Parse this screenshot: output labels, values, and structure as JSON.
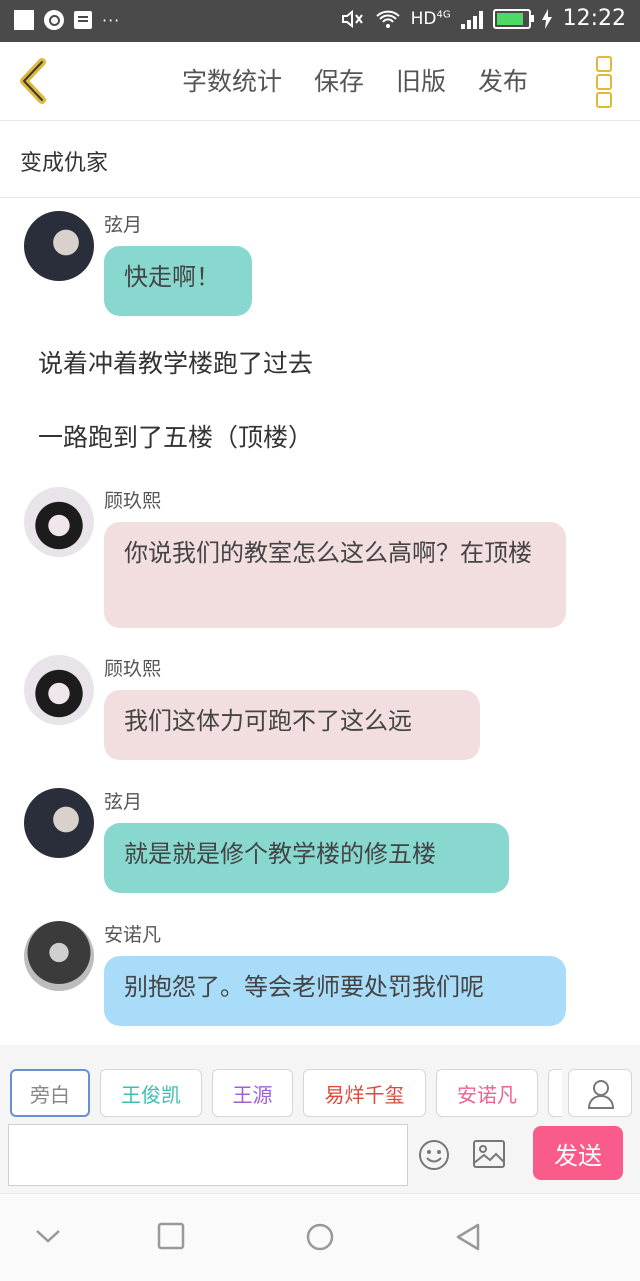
{
  "status_bar": {
    "network": "HD",
    "network_type": "4G",
    "time": "12:22"
  },
  "toolbar": {
    "actions": [
      "字数统计",
      "保存",
      "旧版",
      "发布"
    ]
  },
  "chapter": {
    "title": "变成仇家"
  },
  "messages": [
    {
      "type": "chat",
      "name": "弦月",
      "text": "快走啊！",
      "color": "teal"
    },
    {
      "type": "narration",
      "text": "说着冲着教学楼跑了过去"
    },
    {
      "type": "narration",
      "text": "一路跑到了五楼（顶楼）"
    },
    {
      "type": "chat",
      "name": "顾玖熙",
      "text": "你说我们的教室怎么这么高啊？在顶楼",
      "color": "pink"
    },
    {
      "type": "chat",
      "name": "顾玖熙",
      "text": "我们这体力可跑不了这么远",
      "color": "pink"
    },
    {
      "type": "chat",
      "name": "弦月",
      "text": "就是就是修个教学楼的修五楼",
      "color": "teal"
    },
    {
      "type": "chat",
      "name": "安诺凡",
      "text": "别抱怨了。等会老师要处罚我们呢",
      "color": "blue"
    }
  ],
  "characters": [
    {
      "label": "旁白",
      "color": "#888888",
      "selected": true
    },
    {
      "label": "王俊凯",
      "color": "#3bbfb3"
    },
    {
      "label": "王源",
      "color": "#a05fd8"
    },
    {
      "label": "易烊千玺",
      "color": "#e0493a"
    },
    {
      "label": "安诺凡",
      "color": "#f06292"
    }
  ],
  "input": {
    "placeholder": ""
  },
  "send_label": "发送",
  "colors": {
    "teal": "#88d8d0",
    "pink": "#f2dede",
    "blue": "#a8dcf8",
    "send": "#f95b8b",
    "menu": "#e0b93a"
  }
}
